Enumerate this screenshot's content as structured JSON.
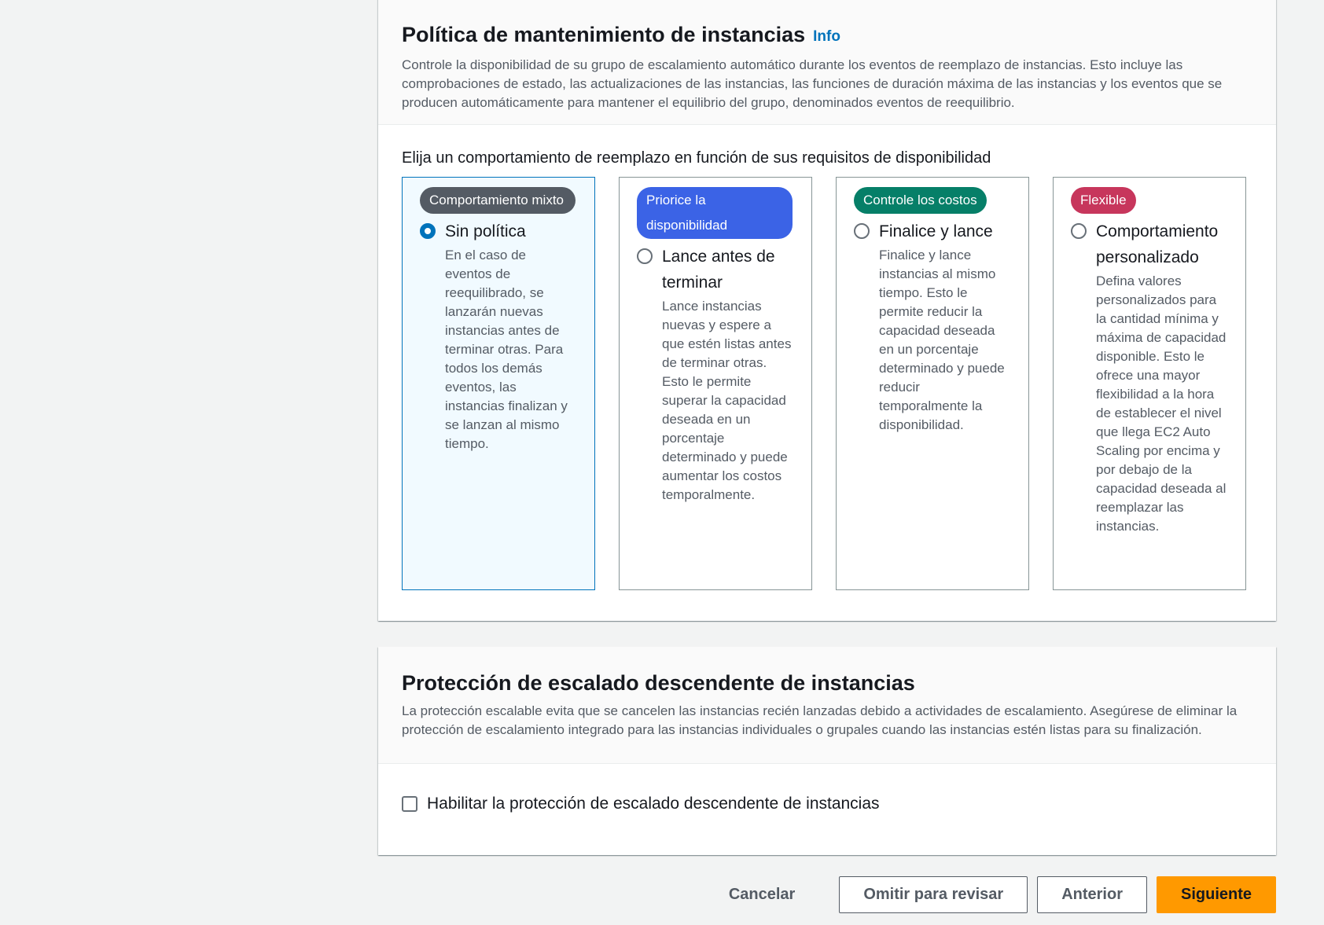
{
  "maintenance_policy": {
    "title": "Política de mantenimiento de instancias",
    "info": "Info",
    "description": "Controle la disponibilidad de su grupo de escalamiento automático durante los eventos de reemplazo de instancias. Esto incluye las comprobaciones de estado, las actualizaciones de las instancias, las funciones de duración máxima de las instancias y los eventos que se producen automáticamente para mantener el equilibrio del grupo, denominados eventos de reequilibrio.",
    "choice_label": "Elija un comportamiento de reemplazo en función de sus requisitos de disponibilidad",
    "options": [
      {
        "badge": "Comportamiento mixto",
        "badge_color": "#545b64",
        "title": "Sin política",
        "description": "En el caso de eventos de reequilibrado, se lanzarán nuevas instancias antes de terminar otras. Para todos los demás eventos, las instancias finalizan y se lanzan al mismo tiempo.",
        "selected": true
      },
      {
        "badge": "Priorice la disponibilidad",
        "badge_color": "#3b63e6",
        "title": "Lance antes de terminar",
        "description": "Lance instancias nuevas y espere a que estén listas antes de terminar otras. Esto le permite superar la capacidad deseada en un porcentaje determinado y puede aumentar los costos temporalmente.",
        "selected": false
      },
      {
        "badge": "Controle los costos",
        "badge_color": "#067f68",
        "title": "Finalice y lance",
        "description": "Finalice y lance instancias al mismo tiempo. Esto le permite reducir la capacidad deseada en un porcentaje determinado y puede reducir temporalmente la disponibilidad.",
        "selected": false
      },
      {
        "badge": "Flexible",
        "badge_color": "#c7365c",
        "title": "Comportamiento personalizado",
        "description": "Defina valores personalizados para la cantidad mínima y máxima de capacidad disponible. Esto le ofrece una mayor flexibilidad a la hora de establecer el nivel que llega EC2 Auto Scaling por encima y por debajo de la capacidad deseada al reemplazar las instancias.",
        "selected": false
      }
    ]
  },
  "scale_in_protection": {
    "title": "Protección de escalado descendente de instancias",
    "description": "La protección escalable evita que se cancelen las instancias recién lanzadas debido a actividades de escalamiento. Asegúrese de eliminar la protección de escalamiento integrado para las instancias individuales o grupales cuando las instancias estén listas para su finalización.",
    "checkbox_label": "Habilitar la protección de escalado descendente de instancias",
    "checked": false
  },
  "actions": {
    "cancel": "Cancelar",
    "skip_to_review": "Omitir para revisar",
    "previous": "Anterior",
    "next": "Siguiente"
  }
}
